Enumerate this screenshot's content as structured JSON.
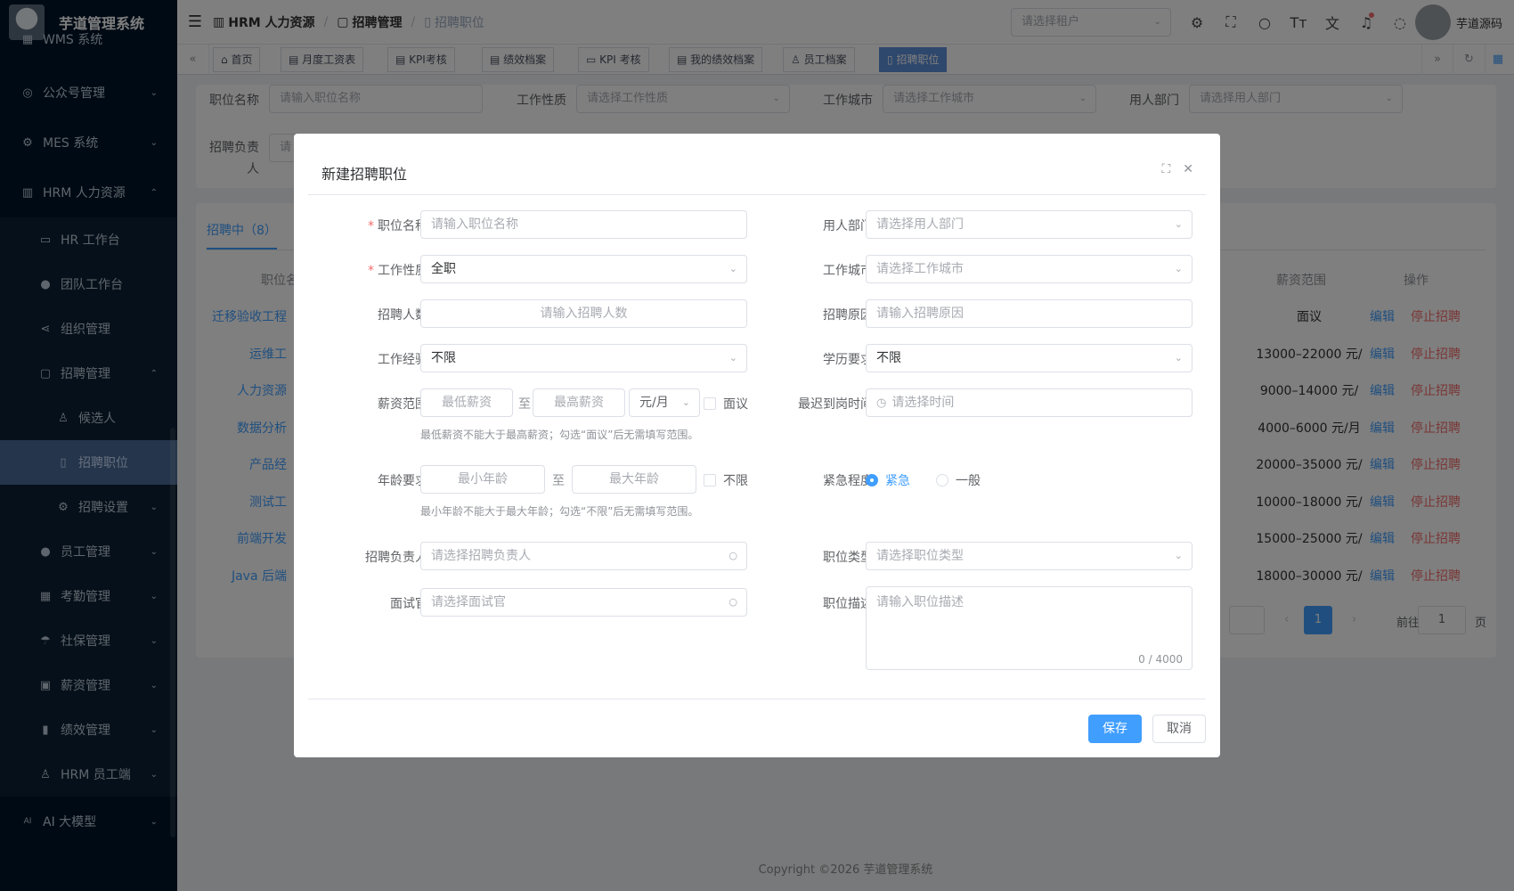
{
  "app": {
    "title": "芋道管理系统"
  },
  "sidebar": {
    "items": [
      {
        "label": "WMS 系统",
        "icon": "grid-icon"
      },
      {
        "label": "公众号管理",
        "icon": "compass-icon",
        "arrow": "⌄"
      },
      {
        "label": "MES 系统",
        "icon": "gear-icon",
        "arrow": "⌄"
      },
      {
        "label": "HRM 人力资源",
        "icon": "building-icon",
        "arrow": "⌃"
      }
    ],
    "hrm_children": [
      {
        "label": "HR 工作台",
        "icon": "monitor-icon"
      },
      {
        "label": "团队工作台",
        "icon": "user-icon"
      },
      {
        "label": "组织管理",
        "icon": "share-icon"
      },
      {
        "label": "招聘管理",
        "icon": "briefcase-icon",
        "arrow": "⌃"
      }
    ],
    "recruit_children": [
      {
        "label": "候选人",
        "icon": "person-icon"
      },
      {
        "label": "招聘职位",
        "icon": "bookmark-icon"
      },
      {
        "label": "招聘设置",
        "icon": "gear-icon",
        "arrow": "⌄"
      }
    ],
    "hrm_tail": [
      {
        "label": "员工管理",
        "icon": "user-icon",
        "arrow": "⌄"
      },
      {
        "label": "考勤管理",
        "icon": "calendar-icon",
        "arrow": "⌄"
      },
      {
        "label": "社保管理",
        "icon": "umbrella-icon",
        "arrow": "⌄"
      },
      {
        "label": "薪资管理",
        "icon": "wallet-icon",
        "arrow": "⌄"
      },
      {
        "label": "绩效管理",
        "icon": "bar-chart-icon",
        "arrow": "⌄"
      },
      {
        "label": "HRM 员工端",
        "icon": "person-icon",
        "arrow": "⌄"
      }
    ],
    "ai_item": {
      "label": "AI 大模型",
      "icon": "ai-icon",
      "arrow": "⌄"
    }
  },
  "header": {
    "breadcrumb": [
      "HRM 人力资源",
      "招聘管理",
      "招聘职位"
    ],
    "tenant_placeholder": "请选择租户",
    "user_name": "芋道源码"
  },
  "tags": [
    {
      "label": "首页",
      "icon": "⌂"
    },
    {
      "label": "月度工资表",
      "icon": "▤"
    },
    {
      "label": "KPI考核",
      "icon": "▤"
    },
    {
      "label": "绩效档案",
      "icon": "▤"
    },
    {
      "label": "KPI 考核",
      "icon": "▭"
    },
    {
      "label": "我的绩效档案",
      "icon": "▤"
    },
    {
      "label": "员工档案",
      "icon": "♙"
    },
    {
      "label": "招聘职位",
      "icon": "▯"
    }
  ],
  "search": {
    "name_label": "职位名称",
    "name_placeholder": "请输入职位名称",
    "type_label": "工作性质",
    "type_placeholder": "请选择工作性质",
    "city_label": "工作城市",
    "city_placeholder": "请选择工作城市",
    "dept_label": "用人部门",
    "dept_placeholder": "请选择用人部门",
    "owner_label": "招聘负责",
    "owner_label2": "人",
    "owner_placeholder": "请"
  },
  "table": {
    "tab": "招聘中（8）",
    "col_name": "职位名",
    "col_salary": "薪资范围",
    "col_ops": "操作",
    "rows": [
      {
        "name": "迁移验收工程",
        "salary": "面议"
      },
      {
        "name": "运维工",
        "salary": "13000–22000 元/"
      },
      {
        "name": "人力资源",
        "salary": "9000–14000 元/"
      },
      {
        "name": "数据分析",
        "salary": "4000–6000 元/月"
      },
      {
        "name": "产品经",
        "salary": "20000–35000 元/"
      },
      {
        "name": "测试工",
        "salary": "10000–18000 元/"
      },
      {
        "name": "前端开发",
        "salary": "15000–25000 元/"
      },
      {
        "name": "Java 后端",
        "salary": "18000–30000 元/"
      }
    ],
    "edit": "编辑",
    "stop": "停止招聘",
    "page_current": "1",
    "goto_label": "前往",
    "goto_value": "1",
    "page_suffix": "页"
  },
  "copyright": "Copyright ©2026 芋道管理系统",
  "dialog": {
    "title": "新建招聘职位",
    "job_name_label": "职位名称",
    "job_name_placeholder": "请输入职位名称",
    "dept_label": "用人部门",
    "dept_placeholder": "请选择用人部门",
    "work_type_label": "工作性质",
    "work_type_value": "全职",
    "city_label": "工作城市",
    "city_placeholder": "请选择工作城市",
    "count_label": "招聘人数",
    "count_placeholder": "请输入招聘人数",
    "reason_label": "招聘原因",
    "reason_placeholder": "请输入招聘原因",
    "exp_label": "工作经验",
    "exp_value": "不限",
    "edu_label": "学历要求",
    "edu_value": "不限",
    "salary_label": "薪资范围",
    "salary_min_placeholder": "最低薪资",
    "salary_to": "至",
    "salary_max_placeholder": "最高薪资",
    "salary_unit": "元/月",
    "salary_negotiable": "面议",
    "salary_hint": "最低薪资不能大于最高薪资；勾选“面议”后无需填写范围。",
    "arrival_label": "最迟到岗时间",
    "arrival_placeholder": "请选择时间",
    "age_label": "年龄要求",
    "age_min_placeholder": "最小年龄",
    "age_to": "至",
    "age_max_placeholder": "最大年龄",
    "age_unlimited": "不限",
    "age_hint": "最小年龄不能大于最大年龄；勾选“不限”后无需填写范围。",
    "urgency_label": "紧急程度",
    "urgency_options": [
      "紧急",
      "一般"
    ],
    "urgency_selected": "紧急",
    "owner_label": "招聘负责人",
    "owner_placeholder": "请选择招聘负责人",
    "job_type_label": "职位类型",
    "job_type_placeholder": "请选择职位类型",
    "interviewer_label": "面试官",
    "interviewer_placeholder": "请选择面试官",
    "desc_label": "职位描述",
    "desc_placeholder": "请输入职位描述",
    "desc_count": "0 / 4000",
    "save_label": "保存",
    "cancel_label": "取消"
  },
  "colors": {
    "sidebar_bg": "#001529",
    "active_menu": "#4a6b96",
    "primary": "#409eff",
    "danger": "#f56c6c"
  }
}
